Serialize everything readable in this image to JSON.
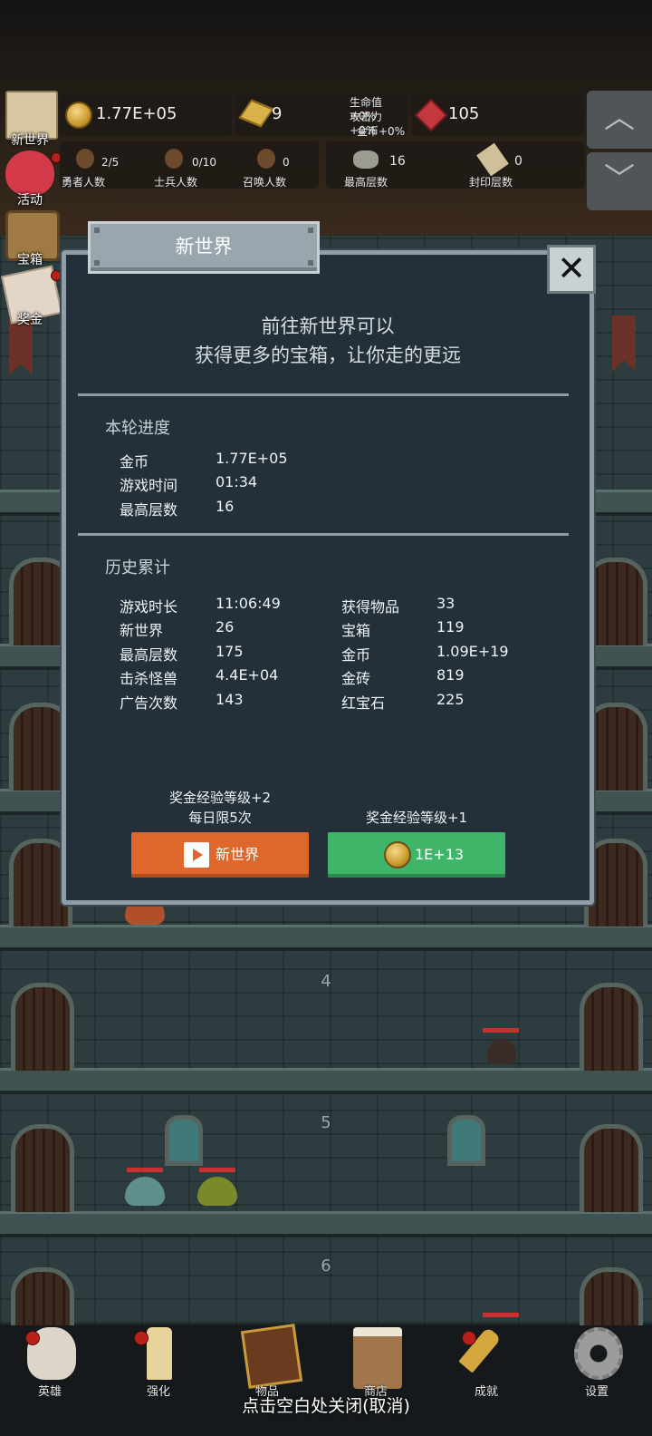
{
  "side_menu": [
    {
      "label": "新世界",
      "icon": "map-scroll-icon"
    },
    {
      "label": "活动",
      "icon": "heart-icon"
    },
    {
      "label": "宝箱",
      "icon": "chest-icon"
    },
    {
      "label": "奖金",
      "icon": "envelope-icon"
    }
  ],
  "resources": {
    "gold": "1.77E+05",
    "gold_bar": "9",
    "ruby": "105",
    "bonus_hp": "生命值+0%",
    "bonus_atk": "攻击力+0%",
    "bonus_gold": "金币+0%"
  },
  "stats": [
    {
      "value": "2/5",
      "label": "勇者人数"
    },
    {
      "value": "0/10",
      "label": "士兵人数"
    },
    {
      "value": "0",
      "label": "召唤人数"
    },
    {
      "value": "16",
      "label": "最高层数"
    },
    {
      "value": "0",
      "label": "封印层数"
    }
  ],
  "floors": [
    "4",
    "5",
    "6"
  ],
  "modal": {
    "title": "新世界",
    "intro_line1": "前往新世界可以",
    "intro_line2": "获得更多的宝箱，让你走的更远",
    "round_title": "本轮进度",
    "round": [
      {
        "k": "金币",
        "v": "1.77E+05"
      },
      {
        "k": "游戏时间",
        "v": "01:34"
      },
      {
        "k": "最高层数",
        "v": "16"
      }
    ],
    "history_title": "历史累计",
    "history_left": [
      {
        "k": "游戏时长",
        "v": "11:06:49"
      },
      {
        "k": "新世界",
        "v": "26"
      },
      {
        "k": "最高层数",
        "v": "175"
      },
      {
        "k": "击杀怪兽",
        "v": "4.4E+04"
      },
      {
        "k": "广告次数",
        "v": "143"
      }
    ],
    "history_right": [
      {
        "k": "获得物品",
        "v": "33"
      },
      {
        "k": "宝箱",
        "v": "119"
      },
      {
        "k": "金币",
        "v": "1.09E+19"
      },
      {
        "k": "金砖",
        "v": "819"
      },
      {
        "k": "红宝石",
        "v": "225"
      }
    ],
    "left_caption_1": "奖金经验等级+2",
    "left_caption_2": "每日限5次",
    "left_button": "新世界",
    "right_caption": "奖金经验等级+1",
    "right_button": "1E+13"
  },
  "nav": [
    {
      "label": "英雄",
      "icon": "skull-icon"
    },
    {
      "label": "强化",
      "icon": "candle-icon"
    },
    {
      "label": "物品",
      "icon": "book-icon"
    },
    {
      "label": "商店",
      "icon": "mug-icon"
    },
    {
      "label": "成就",
      "icon": "key-icon"
    },
    {
      "label": "设置",
      "icon": "gear-icon"
    }
  ],
  "close_hint": "点击空白处关闭(取消)"
}
